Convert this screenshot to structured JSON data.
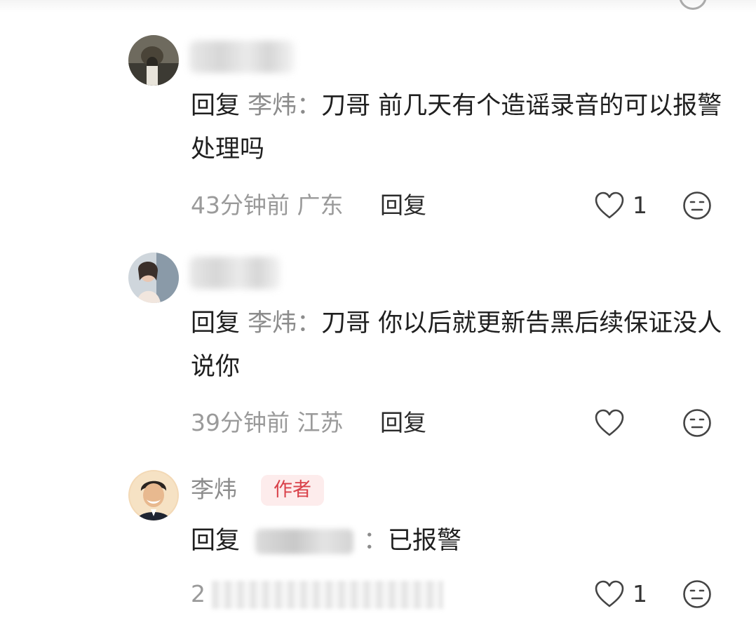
{
  "comments": [
    {
      "reply_word": "回复",
      "reply_target": "李炜：",
      "text": "刀哥 前几天有个造谣录音的可以报警处理吗",
      "time": "43分钟前",
      "region": "广东",
      "reply_label": "回复",
      "likes": "1",
      "like_icon": "heart-outline-icon",
      "dislike_icon": "neutral-face-icon"
    },
    {
      "reply_word": "回复",
      "reply_target": "李炜：",
      "text": "刀哥 你以后就更新告黑后续保证没人说你",
      "time": "39分钟前",
      "region": "江苏",
      "reply_label": "回复",
      "likes": "",
      "like_icon": "heart-outline-icon",
      "dislike_icon": "neutral-face-icon"
    },
    {
      "username": "李炜",
      "author_tag": "作者",
      "reply_word": "回复",
      "reply_separator": "：",
      "text": "已报警",
      "time_prefix": "2",
      "likes": "1",
      "like_icon": "heart-outline-icon",
      "dislike_icon": "neutral-face-icon"
    }
  ],
  "colors": {
    "author_tag_text": "#d9414a",
    "author_tag_bg": "#fdecec",
    "meta_gray": "#9a9a9a",
    "username_gray": "#8c8c8c"
  }
}
